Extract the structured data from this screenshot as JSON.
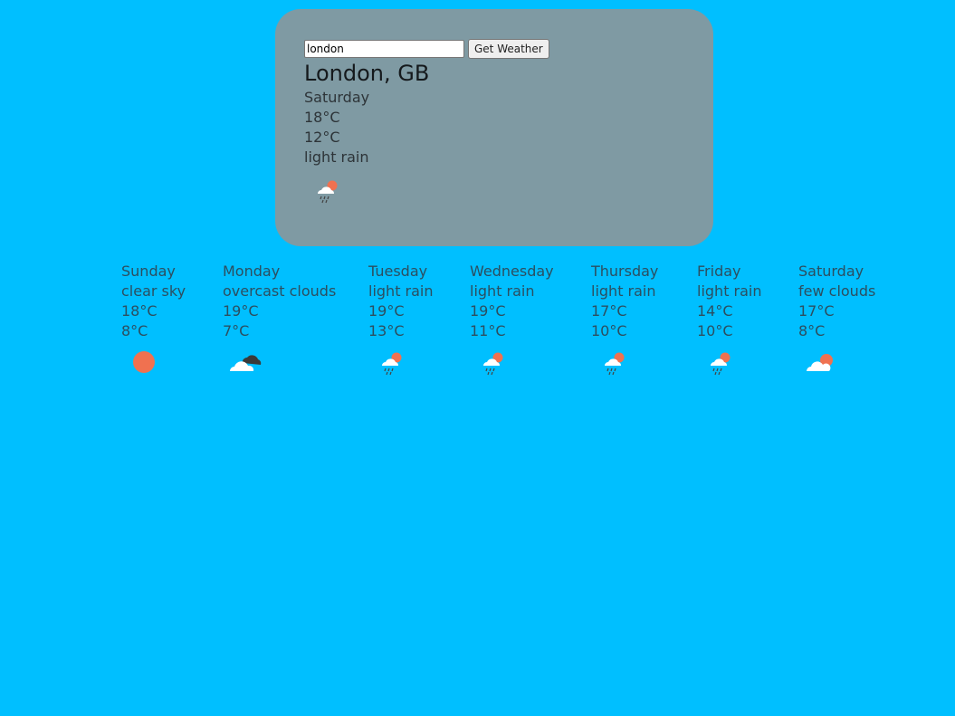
{
  "search": {
    "value": "london",
    "button_label": "Get Weather"
  },
  "current": {
    "city": "London, GB",
    "day": "Saturday",
    "high": "18°C",
    "low": "12°C",
    "description": "light rain",
    "icon": "light-rain-icon"
  },
  "forecast": [
    {
      "day": "Sunday",
      "description": "clear sky",
      "high": "18°C",
      "low": "8°C",
      "icon": "sun-icon"
    },
    {
      "day": "Monday",
      "description": "overcast clouds",
      "high": "19°C",
      "low": "7°C",
      "icon": "overcast-clouds-icon"
    },
    {
      "day": "Tuesday",
      "description": "light rain",
      "high": "19°C",
      "low": "13°C",
      "icon": "light-rain-icon"
    },
    {
      "day": "Wednesday",
      "description": "light rain",
      "high": "19°C",
      "low": "11°C",
      "icon": "light-rain-icon"
    },
    {
      "day": "Thursday",
      "description": "light rain",
      "high": "17°C",
      "low": "10°C",
      "icon": "light-rain-icon"
    },
    {
      "day": "Friday",
      "description": "light rain",
      "high": "14°C",
      "low": "10°C",
      "icon": "light-rain-icon"
    },
    {
      "day": "Saturday",
      "description": "few clouds",
      "high": "17°C",
      "low": "8°C",
      "icon": "few-clouds-icon"
    }
  ],
  "colors": {
    "background": "#00bfff",
    "card": "#7f9aa3",
    "sun": "#f07150",
    "cloud": "#ffffff",
    "dark_cloud": "#3a3a3a"
  }
}
